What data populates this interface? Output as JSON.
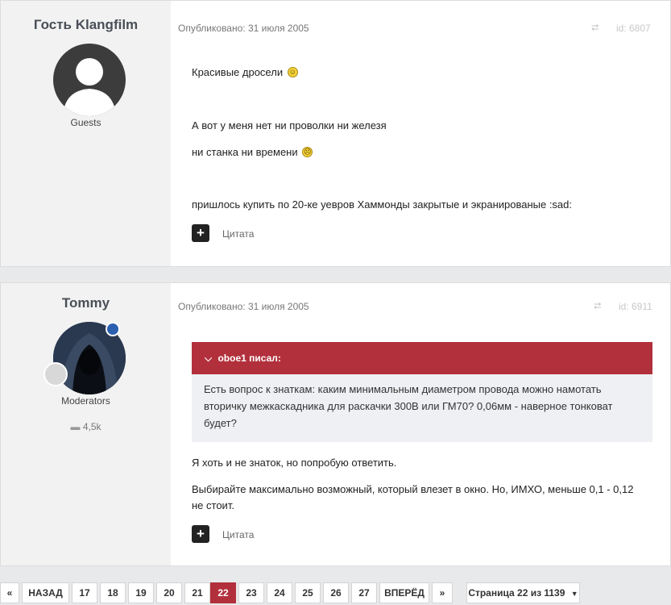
{
  "posts": [
    {
      "author": "Гость Klangfilm",
      "group": "Guests",
      "published": "Опубликовано: 31 июля 2005",
      "id_label": "id: 6807",
      "paragraphs": [
        "Красивые дросели",
        "А вот у меня нет ни проволки ни железя",
        "ни станка ни времени",
        "пришлось купить по 20-ке уевров Хаммонды закрытые и экранированые :sad:"
      ],
      "quote_button": "Цитата"
    },
    {
      "author": "Tommy",
      "group": "Moderators",
      "reputation": "4,5k",
      "published": "Опубликовано: 31 июля 2005",
      "id_label": "id: 6911",
      "quote_author": "oboe1 писал:",
      "quote_lines": [
        "Есть вопрос к знаткам: каким минимальным диаметром провода можно намотать",
        "вторичку межкаскадника для раскачки 300В или ГМ70? 0,06мм - наверное тонковат",
        "будет?"
      ],
      "paragraphs": [
        "Я хоть и не знаток, но попробую ответить.",
        "Выбирайте максимально возможный, который влезет в окно. Но, ИМХО, меньше 0,1 - 0,12",
        "не стоит."
      ],
      "quote_button": "Цитата"
    }
  ],
  "pagination": {
    "first": "«",
    "prev": "НАЗАД",
    "pages": [
      "17",
      "18",
      "19",
      "20",
      "21",
      "22",
      "23",
      "24",
      "25",
      "26",
      "27"
    ],
    "current": "22",
    "next": "ВПЕРЁД",
    "last": "»",
    "page_select": "Страница 22 из 1139"
  },
  "colors": {
    "accent": "#b2303c",
    "author_panel": "#f2f2f2"
  }
}
